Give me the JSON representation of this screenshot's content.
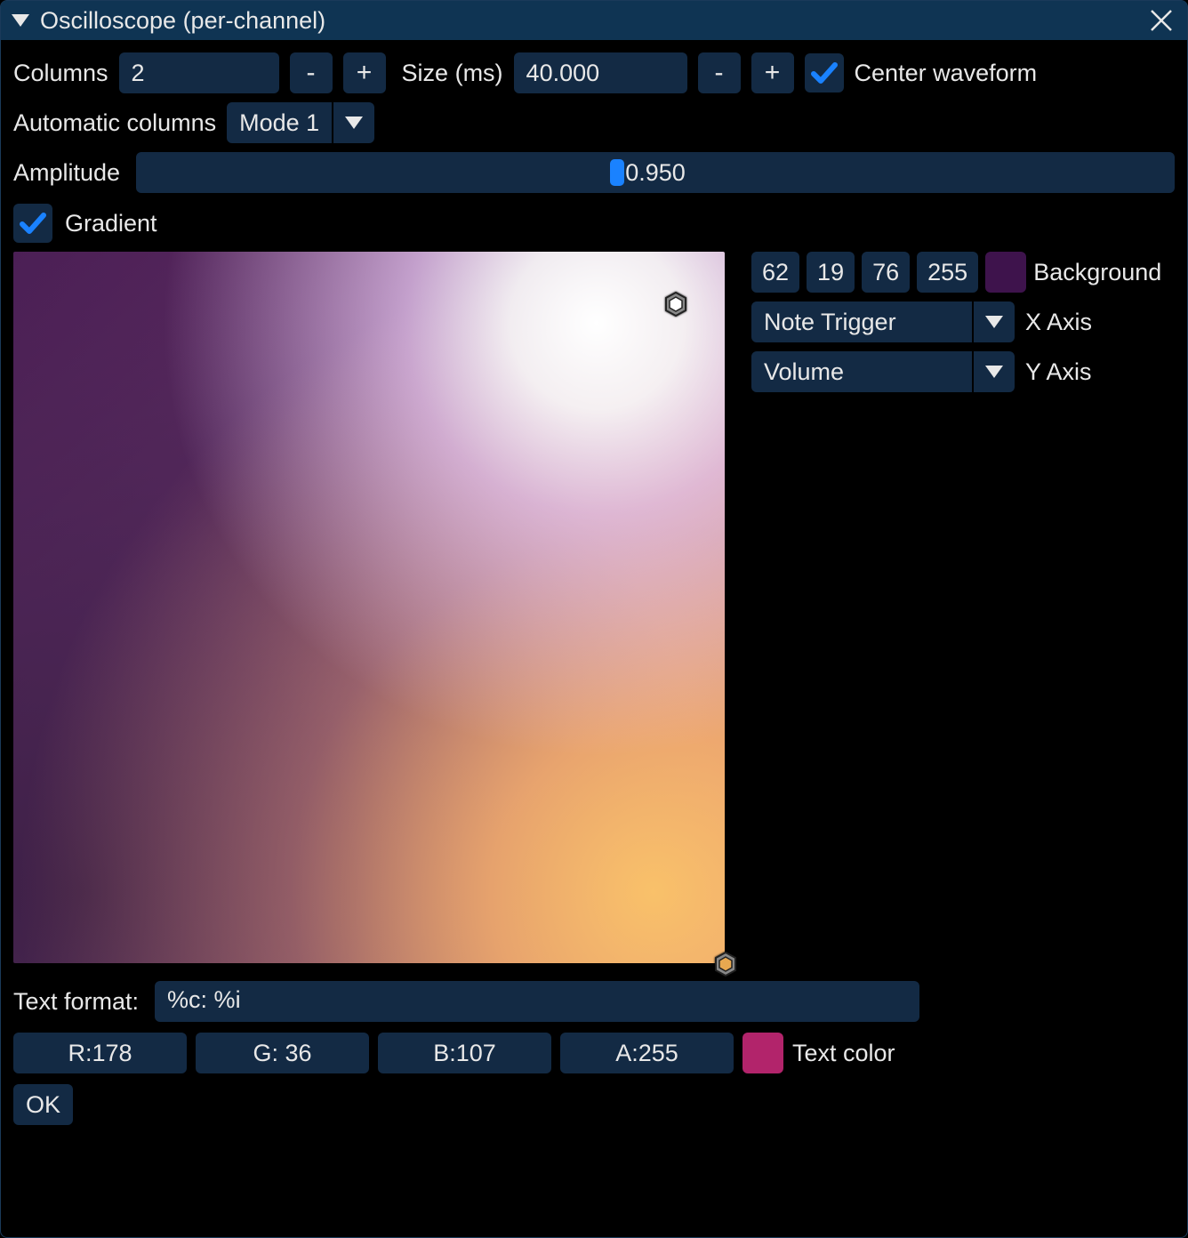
{
  "title": "Oscilloscope (per-channel)",
  "columns": {
    "label": "Columns",
    "value": "2"
  },
  "size": {
    "label": "Size (ms)",
    "value": "40.000"
  },
  "center_waveform": {
    "label": "Center waveform",
    "checked": true
  },
  "auto_columns": {
    "label": "Automatic columns",
    "value": "Mode 1"
  },
  "amplitude": {
    "label": "Amplitude",
    "value": "0.950"
  },
  "gradient": {
    "label": "Gradient",
    "checked": true
  },
  "background": {
    "label": "Background",
    "r": "62",
    "g": "19",
    "b": "76",
    "a": "255",
    "hex": "#3e134c"
  },
  "x_axis": {
    "label": "X Axis",
    "value": "Note Trigger"
  },
  "y_axis": {
    "label": "Y Axis",
    "value": "Volume"
  },
  "text_format": {
    "label": "Text format:",
    "value": "%c: %i"
  },
  "text_color": {
    "label": "Text color",
    "r": "R:178",
    "g": "G: 36",
    "b": "B:107",
    "a": "A:255",
    "hex": "#b2246b"
  },
  "ok": "OK",
  "minus": "-",
  "plus": "+"
}
